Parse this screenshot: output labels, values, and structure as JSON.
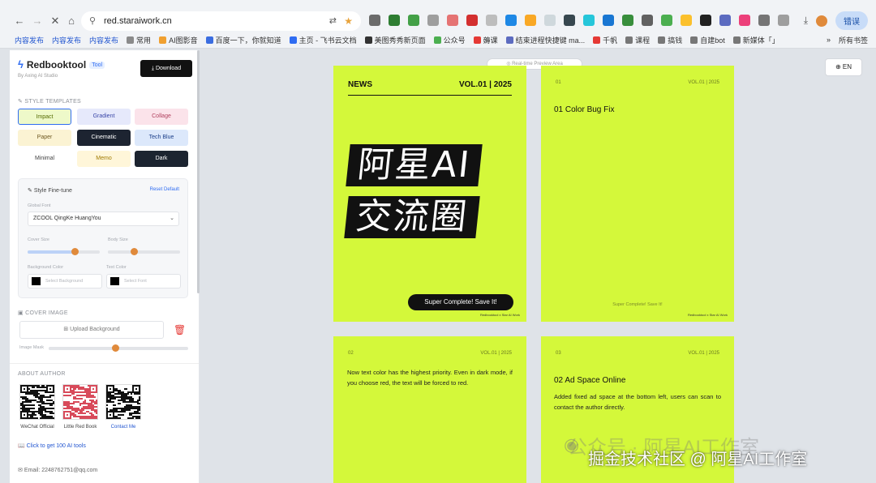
{
  "browser": {
    "url": "red.staraiwork.cn",
    "error_button": "错误",
    "bookmarks": [
      {
        "label": "内容发布",
        "blue": true
      },
      {
        "label": "内容发布",
        "blue": true
      },
      {
        "label": "内容发布",
        "blue": true
      },
      {
        "label": "常用",
        "blue": false
      },
      {
        "label": "AI图影音",
        "blue": false
      },
      {
        "label": "百度一下，你就知道",
        "blue": false
      },
      {
        "label": "主页 - 飞书云文档",
        "blue": false
      },
      {
        "label": "美图秀秀新页面",
        "blue": false
      },
      {
        "label": "公众号",
        "blue": false
      },
      {
        "label": "薅课",
        "blue": false
      },
      {
        "label": "结束进程快捷键 ma...",
        "blue": false
      },
      {
        "label": "千帆",
        "blue": false
      },
      {
        "label": "课程",
        "blue": false
      },
      {
        "label": "搞钱",
        "blue": false
      },
      {
        "label": "自建bot",
        "blue": false
      },
      {
        "label": "新媒体「」",
        "blue": false
      }
    ],
    "all_bookmarks": "所有书签",
    "colors": {
      "accent": "#2155d0",
      "chrome_bg": "#f1f3f6"
    }
  },
  "sidebar": {
    "brand": "Redbooktool",
    "tag": "Tool",
    "byline": "By Axing AI Studio",
    "download": "Download",
    "style_templates_label": "STYLE TEMPLATES",
    "templates": [
      {
        "label": "Impact",
        "bg": "#eef9c9",
        "fg": "#556b00"
      },
      {
        "label": "Gradient",
        "bg": "#e6e9fb",
        "fg": "#3a47a8"
      },
      {
        "label": "Collage",
        "bg": "#fbe3ea",
        "fg": "#b0405e"
      },
      {
        "label": "Paper",
        "bg": "#fbf3d3",
        "fg": "#6f5a22"
      },
      {
        "label": "Cinematic",
        "bg": "#1d2431",
        "fg": "#ffffff"
      },
      {
        "label": "Tech Blue",
        "bg": "#dce8fb",
        "fg": "#1c3f8a"
      },
      {
        "label": "Minimal",
        "bg": "#ffffff",
        "fg": "#444444"
      },
      {
        "label": "Memo",
        "bg": "#fff6d9",
        "fg": "#a07a00"
      },
      {
        "label": "Dark",
        "bg": "#1c2430",
        "fg": "#ffffff"
      }
    ],
    "finetune": {
      "title": "Style Fine-tune",
      "reset": "Reset Default",
      "global_font_label": "Global Font",
      "font_value": "ZCOOL QingKe HuangYou",
      "cover_size_label": "Cover Size",
      "body_size_label": "Body Size",
      "cover_size_level": 0.66,
      "body_size_level": 0.36,
      "bg_color_label": "Background Color",
      "text_color_label": "Text Color",
      "bg_placeholder": "Select Background",
      "text_placeholder": "Select Font"
    },
    "cover_image_label": "COVER IMAGE",
    "upload_label": "Upload Background",
    "image_mask_label": "Image Mask",
    "image_mask_level": 0.48,
    "about_label": "ABOUT AUTHOR",
    "qr_codes": [
      {
        "label": "WeChat Official"
      },
      {
        "label": "Little Red Book"
      },
      {
        "label": "Contact Me"
      }
    ],
    "tools_link": "Click to get 100 AI tools",
    "email": "Email: 2248762751@qq.com"
  },
  "preview": {
    "pill_label": "Real-time Preview Area",
    "lang": "EN",
    "cards": [
      {
        "type": "cover",
        "hdr_left": "NEWS",
        "hdr_right": "VOL.01 | 2025",
        "hero_line1": "阿星AI",
        "hero_line2": "交流圈",
        "save": "Super Complete! Save It!",
        "credit": "Redbooktool x Star AI Work"
      },
      {
        "type": "text",
        "num": "01",
        "vol": "VOL.01 | 2025",
        "title": "01 Color Bug Fix",
        "body": "",
        "foot": "Super Complete! Save It!",
        "credit": "Redbooktool x Star AI Work"
      },
      {
        "type": "text",
        "num": "02",
        "vol": "VOL.01 | 2025",
        "title": "",
        "body": "Now text color has the highest priority. Even in dark mode, if you choose red, the text will be forced to red."
      },
      {
        "type": "text",
        "num": "03",
        "vol": "VOL.01 | 2025",
        "title": "02 Ad Space Online",
        "body": "Added fixed ad space at the bottom left, users can scan to contact the author directly."
      }
    ],
    "card_color": "#d4f83a"
  },
  "watermark": {
    "line1": "公众号 · 阿星AI工作室",
    "line2": "掘金技术社区 @ 阿星AI工作室"
  }
}
